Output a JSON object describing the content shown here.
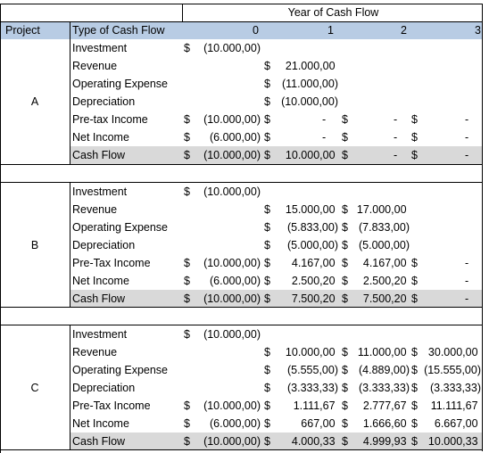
{
  "header": {
    "year_group_label": "Year of Cash Flow",
    "project_label": "Project",
    "type_label": "Type of Cash Flow",
    "years": [
      "0",
      "1",
      "2",
      "3"
    ]
  },
  "colors": {
    "header_fill": "#b8cce4",
    "cash_flow_fill": "#d9d9d9"
  },
  "projects": [
    {
      "name": "A",
      "rows": [
        {
          "type": "Investment",
          "values": [
            [
              "$",
              "(10.000,00)"
            ],
            null,
            null,
            null
          ]
        },
        {
          "type": "Revenue",
          "values": [
            null,
            [
              "$",
              " 21.000,00 "
            ],
            null,
            null
          ]
        },
        {
          "type": "Operating Expense",
          "values": [
            null,
            [
              "$",
              "(11.000,00)"
            ],
            null,
            null
          ]
        },
        {
          "type": "Depreciation",
          "values": [
            null,
            [
              "$",
              "(10.000,00)"
            ],
            null,
            null
          ]
        },
        {
          "type": "Pre-tax Income",
          "values": [
            [
              "$",
              "(10.000,00)"
            ],
            [
              "$",
              "-    "
            ],
            [
              "$",
              "-    "
            ],
            [
              "$",
              "-    "
            ]
          ]
        },
        {
          "type": "Net Income",
          "values": [
            [
              "$",
              "(6.000,00)"
            ],
            [
              "$",
              "-    "
            ],
            [
              "$",
              "-    "
            ],
            [
              "$",
              "-    "
            ]
          ]
        },
        {
          "type": "Cash Flow",
          "values": [
            [
              "$",
              "(10.000,00)"
            ],
            [
              "$",
              " 10.000,00 "
            ],
            [
              "$",
              "-    "
            ],
            [
              "$",
              "-    "
            ]
          ]
        }
      ]
    },
    {
      "name": "B",
      "rows": [
        {
          "type": "Investment",
          "values": [
            [
              "$",
              "(10.000,00)"
            ],
            null,
            null,
            null
          ]
        },
        {
          "type": "Revenue",
          "values": [
            null,
            [
              "$",
              " 15.000,00 "
            ],
            [
              "$",
              "17.000,00 "
            ],
            null
          ]
        },
        {
          "type": "Operating Expense",
          "values": [
            null,
            [
              "$",
              "(5.833,00)"
            ],
            [
              "$",
              "(7.833,00)"
            ],
            null
          ]
        },
        {
          "type": "Depreciation",
          "values": [
            null,
            [
              "$",
              "(5.000,00)"
            ],
            [
              "$",
              "(5.000,00)"
            ],
            null
          ]
        },
        {
          "type": "Pre-Tax Income",
          "values": [
            [
              "$",
              "(10.000,00)"
            ],
            [
              "$",
              " 4.167,00 "
            ],
            [
              "$",
              " 4.167,00 "
            ],
            [
              "$",
              "-    "
            ]
          ]
        },
        {
          "type": "Net Income",
          "values": [
            [
              "$",
              "(6.000,00)"
            ],
            [
              "$",
              " 2.500,20 "
            ],
            [
              "$",
              " 2.500,20 "
            ],
            [
              "$",
              "-    "
            ]
          ]
        },
        {
          "type": "Cash Flow",
          "values": [
            [
              "$",
              "(10.000,00)"
            ],
            [
              "$",
              " 7.500,20 "
            ],
            [
              "$",
              " 7.500,20 "
            ],
            [
              "$",
              "-    "
            ]
          ]
        }
      ]
    },
    {
      "name": "C",
      "rows": [
        {
          "type": "Investment",
          "values": [
            [
              "$",
              "(10.000,00)"
            ],
            null,
            null,
            null
          ]
        },
        {
          "type": "Revenue",
          "values": [
            null,
            [
              "$",
              " 10.000,00 "
            ],
            [
              "$",
              "11.000,00 "
            ],
            [
              "$",
              " 30.000,00 "
            ]
          ]
        },
        {
          "type": "Operating Expense",
          "values": [
            null,
            [
              "$",
              "(5.555,00)"
            ],
            [
              "$",
              "(4.889,00)"
            ],
            [
              "$",
              "(15.555,00)"
            ]
          ]
        },
        {
          "type": "Depreciation",
          "values": [
            null,
            [
              "$",
              "(3.333,33)"
            ],
            [
              "$",
              "(3.333,33)"
            ],
            [
              "$",
              "(3.333,33)"
            ]
          ]
        },
        {
          "type": "Pre-Tax Income",
          "values": [
            [
              "$",
              "(10.000,00)"
            ],
            [
              "$",
              " 1.111,67 "
            ],
            [
              "$",
              " 2.777,67 "
            ],
            [
              "$",
              " 11.111,67 "
            ]
          ]
        },
        {
          "type": "Net Income",
          "values": [
            [
              "$",
              "(6.000,00)"
            ],
            [
              "$",
              " 667,00 "
            ],
            [
              "$",
              " 1.666,60 "
            ],
            [
              "$",
              " 6.667,00 "
            ]
          ]
        },
        {
          "type": "Cash Flow",
          "values": [
            [
              "$",
              "(10.000,00)"
            ],
            [
              "$",
              " 4.000,33 "
            ],
            [
              "$",
              " 4.999,93 "
            ],
            [
              "$",
              " 10.000,33 "
            ]
          ]
        }
      ]
    }
  ]
}
